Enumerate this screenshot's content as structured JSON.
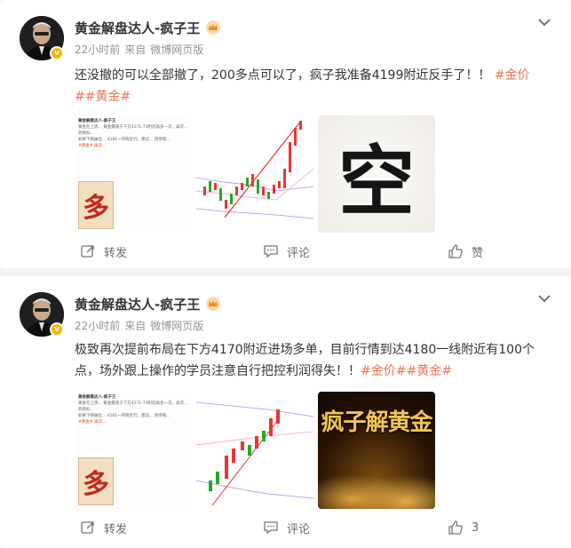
{
  "posts": [
    {
      "author": "黄金解盘达人-疯子王",
      "time": "22小时前",
      "source_prefix": "来自",
      "source": "微博网页版",
      "text": "还没撤的可以全部撤了，200多点可以了，疯子我准备4199附近反手了！！",
      "tags": [
        "#金价",
        "##黄金#"
      ],
      "images": [
        "screenshot",
        "candlestick-chart",
        "kong-calligraphy"
      ],
      "image_texts": {
        "kong": "空"
      },
      "actions": {
        "repost": "转发",
        "comment": "评论",
        "like": "赞"
      }
    },
    {
      "author": "黄金解盘达人-疯子王",
      "time": "22小时前",
      "source_prefix": "来自",
      "source": "微博网页版",
      "text": "极致再次提前布局在下方4170附近进场多单，目前行情到达4180一线附近有100个点，场外跟上操作的学员注意自行把控利润得失！！",
      "tags": [
        "#金价##黄金#"
      ],
      "images": [
        "screenshot",
        "candlestick-chart",
        "gold-poster"
      ],
      "image_texts": {
        "poster_title": "疯子解黄金"
      },
      "actions": {
        "repost": "转发",
        "comment": "评论",
        "like": "3"
      }
    }
  ],
  "thumb_screenshot": {
    "title": "黄金解盘达人-疯子王",
    "lines": [
      "黄金在上周... 黄金震荡于下方4171-73附近再多一次，再次... 到目标...",
      "如果下跌破位... 4181一带附近行，建议... 则参照..."
    ],
    "red_line": "#黄金# 再次...",
    "duo": "多"
  },
  "colors": {
    "accent": "#eb7350",
    "badge": "#f5b400",
    "muted": "#939393"
  }
}
